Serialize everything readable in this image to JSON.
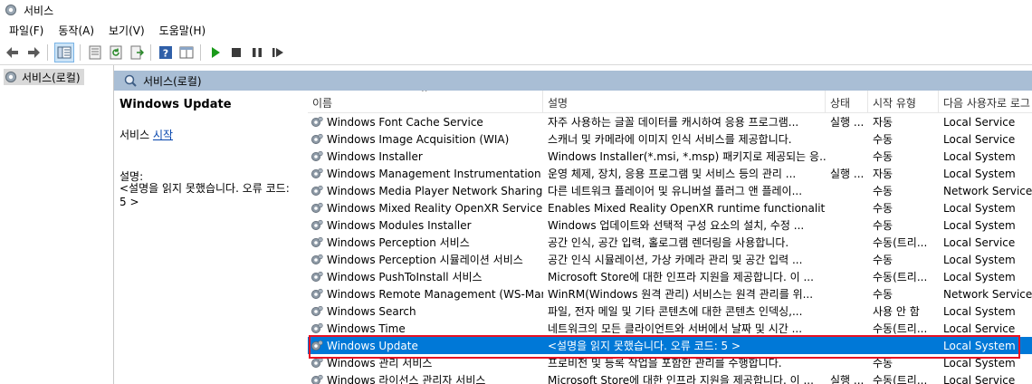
{
  "window": {
    "title": "서비스"
  },
  "menu": [
    "파일(F)",
    "동작(A)",
    "보기(V)",
    "도움말(H)"
  ],
  "tree": {
    "root_label": "서비스(로컬)"
  },
  "panel_header": "서비스(로컬)",
  "detail": {
    "title": "Windows Update",
    "action_prefix": "서비스 ",
    "action_link": "시작",
    "desc_label": "설명:",
    "desc_text": "<설명을 읽지 못했습니다. 오류 코드: 5 >"
  },
  "columns": [
    "이름",
    "설명",
    "상태",
    "시작 유형",
    "다음 사용자로 로그"
  ],
  "rows": [
    {
      "name": "Windows Font Cache Service",
      "desc": "자주 사용하는 글꼴 데이터를 캐시하여 응용 프로그램...",
      "status": "실행 ...",
      "startup": "자동",
      "logon": "Local Service"
    },
    {
      "name": "Windows Image Acquisition (WIA)",
      "desc": "스캐너 및 카메라에 이미지 인식 서비스를 제공합니다.",
      "status": "",
      "startup": "수동",
      "logon": "Local Service"
    },
    {
      "name": "Windows Installer",
      "desc": "Windows Installer(*.msi, *.msp) 패키지로 제공되는 응...",
      "status": "",
      "startup": "수동",
      "logon": "Local System"
    },
    {
      "name": "Windows Management Instrumentation",
      "desc": "운영 체제, 장치, 응용 프로그램 및 서비스 등의 관리 ...",
      "status": "실행 ...",
      "startup": "자동",
      "logon": "Local System"
    },
    {
      "name": "Windows Media Player Network Sharing S...",
      "desc": "다른 네트워크 플레이어 및 유니버설 플러그 앤 플레이...",
      "status": "",
      "startup": "수동",
      "logon": "Network Service"
    },
    {
      "name": "Windows Mixed Reality OpenXR Service",
      "desc": "Enables Mixed Reality OpenXR runtime functionality",
      "status": "",
      "startup": "수동",
      "logon": "Local System"
    },
    {
      "name": "Windows Modules Installer",
      "desc": "Windows 업데이트와 선택적 구성 요소의 설치, 수정 ...",
      "status": "",
      "startup": "수동",
      "logon": "Local System"
    },
    {
      "name": "Windows Perception 서비스",
      "desc": "공간 인식, 공간 입력, 홀로그램 렌더링을 사용합니다.",
      "status": "",
      "startup": "수동(트리...",
      "logon": "Local Service"
    },
    {
      "name": "Windows Perception 시뮬레이션 서비스",
      "desc": "공간 인식 시뮬레이션, 가상 카메라 관리 및 공간 입력 ...",
      "status": "",
      "startup": "수동",
      "logon": "Local System"
    },
    {
      "name": "Windows PushToInstall 서비스",
      "desc": "Microsoft Store에 대한 인프라 지원을 제공합니다. 이 ...",
      "status": "",
      "startup": "수동(트리...",
      "logon": "Local System"
    },
    {
      "name": "Windows Remote Management (WS-Man...",
      "desc": "WinRM(Windows 원격 관리) 서비스는 원격 관리를 위...",
      "status": "",
      "startup": "수동",
      "logon": "Network Service"
    },
    {
      "name": "Windows Search",
      "desc": "파일, 전자 메일 및 기타 콘텐츠에 대한 콘텐츠 인덱싱,...",
      "status": "",
      "startup": "사용 안 함",
      "logon": "Local System"
    },
    {
      "name": "Windows Time",
      "desc": "네트워크의 모든 클라이언트와 서버에서 날짜 및 시간 ...",
      "status": "",
      "startup": "수동(트리...",
      "logon": "Local Service"
    },
    {
      "name": "Windows Update",
      "desc": "<설명을 읽지 못했습니다. 오류 코드: 5 >",
      "status": "",
      "startup": "",
      "logon": "Local System",
      "selected": true
    },
    {
      "name": "Windows 관리 서비스",
      "desc": "프로비전 및 등록 작업을 포함한 관리를 수행합니다.",
      "status": "",
      "startup": "수동",
      "logon": "Local System"
    },
    {
      "name": "Windows 라이선스 관리자 서비스",
      "desc": "Microsoft Store에 대한 인프라 지원을 제공합니다. 이 ...",
      "status": "실행 ...",
      "startup": "수동(트리...",
      "logon": "Local Service"
    }
  ],
  "colors": {
    "selection": "#0078d7",
    "highlight_box": "#e81123",
    "panel_header": "#a9bed5"
  }
}
